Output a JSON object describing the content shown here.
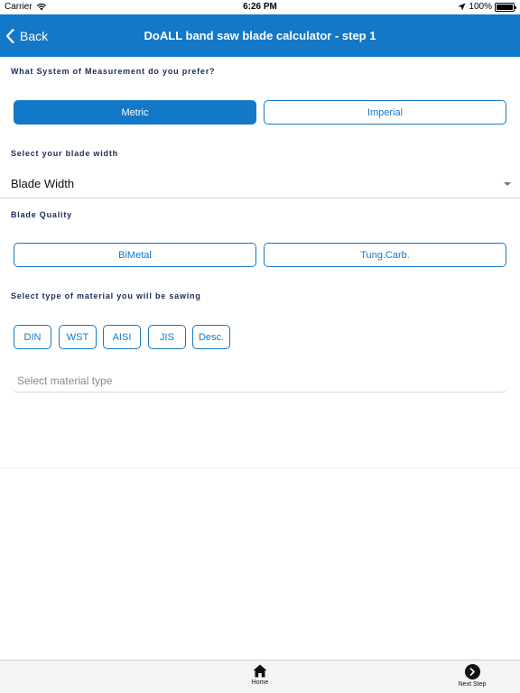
{
  "status_bar": {
    "carrier": "Carrier",
    "time": "6:26 PM",
    "battery": "100%"
  },
  "nav": {
    "back_label": "Back",
    "title": "DoALL band saw blade calculator - step 1"
  },
  "measurement": {
    "label": "What System of Measurement do you prefer?",
    "options": [
      "Metric",
      "Imperial"
    ],
    "selected": "Metric"
  },
  "blade_width": {
    "label": "Select your blade width",
    "value": "Blade Width"
  },
  "blade_quality": {
    "label": "Blade Quality",
    "options": [
      "BiMetal",
      "Tung.Carb."
    ]
  },
  "material": {
    "label": "Select type of material you will be sawing",
    "standards": [
      "DIN",
      "WST",
      "AISI",
      "JIS",
      "Desc."
    ],
    "input_placeholder": "Select material type"
  },
  "tab_bar": {
    "home_label": "Home",
    "next_label": "Next Step"
  },
  "colors": {
    "accent": "#1378c8",
    "label_text": "#1a2a5a"
  }
}
